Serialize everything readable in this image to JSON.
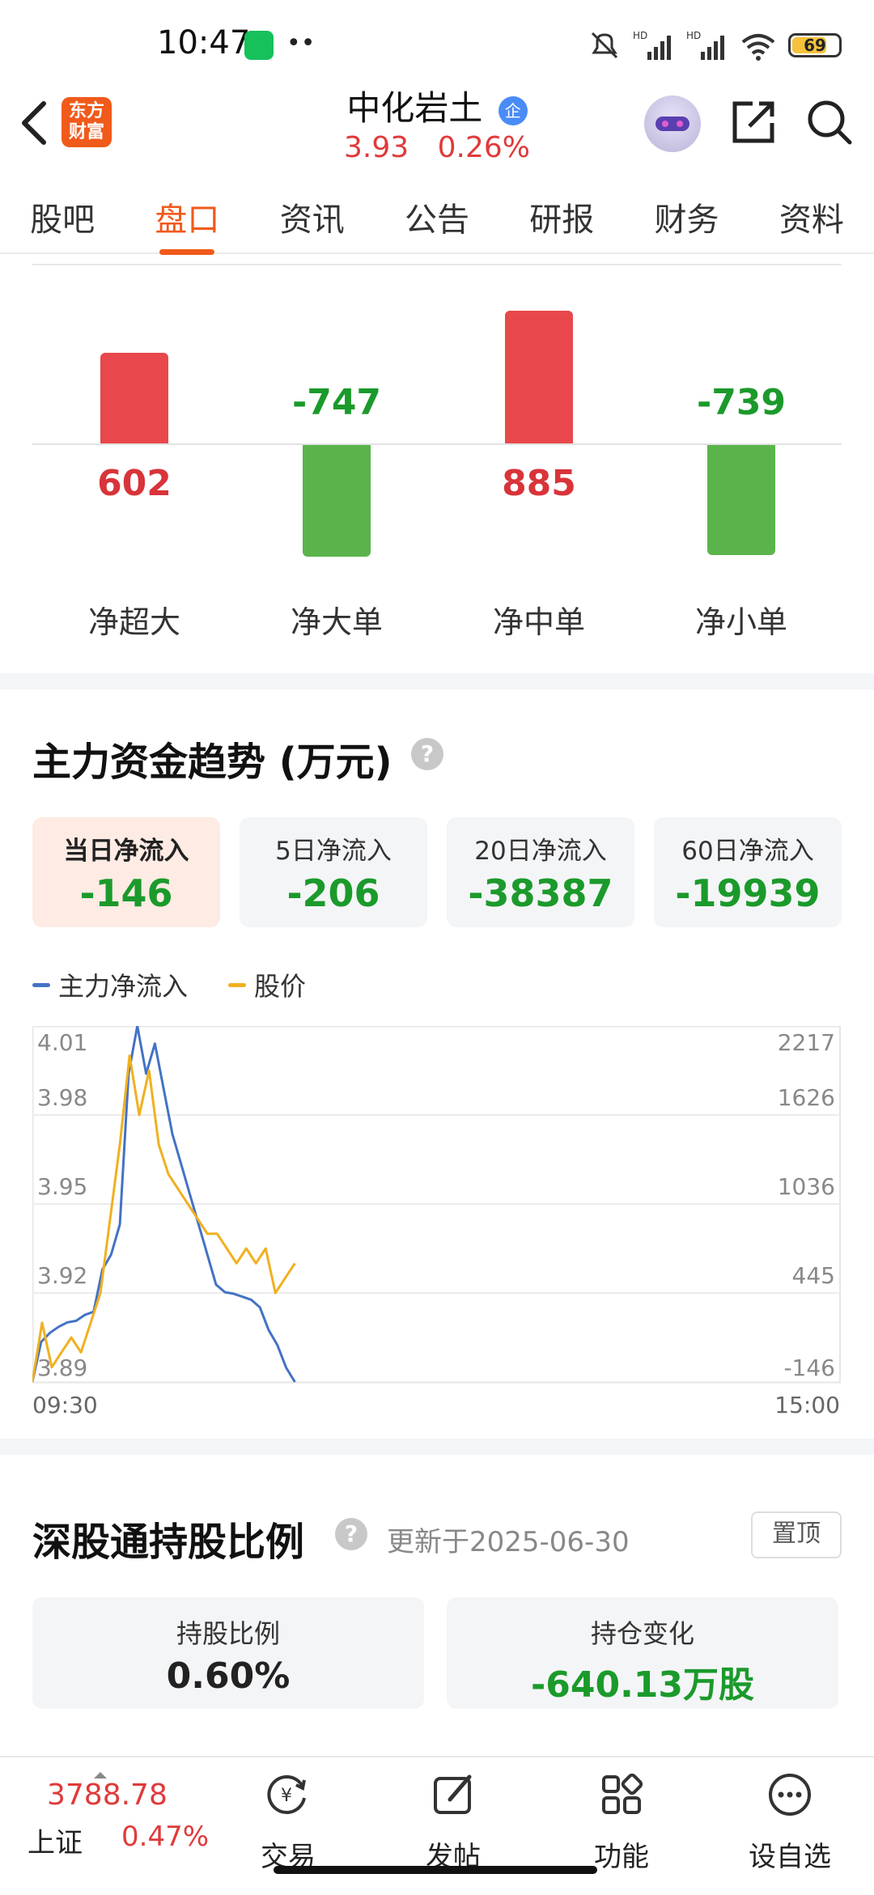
{
  "status_bar": {
    "time": "10:47",
    "battery": "69"
  },
  "header": {
    "logo_line1": "东方",
    "logo_line2": "财富",
    "stock_name": "中化岩土",
    "badge": "企",
    "price": "3.93",
    "change_pct": "0.26%"
  },
  "tabs": [
    "股吧",
    "盘口",
    "资讯",
    "公告",
    "研报",
    "财务",
    "资料"
  ],
  "active_tab": "盘口",
  "net_flow": [
    {
      "label": "净超大",
      "value": "602"
    },
    {
      "label": "净大单",
      "value": "-747"
    },
    {
      "label": "净中单",
      "value": "885"
    },
    {
      "label": "净小单",
      "value": "-739"
    }
  ],
  "trend": {
    "title": "主力资金趋势 (万元)",
    "cards": [
      {
        "label": "当日净流入",
        "value": "-146"
      },
      {
        "label": "5日净流入",
        "value": "-206"
      },
      {
        "label": "20日净流入",
        "value": "-38387"
      },
      {
        "label": "60日净流入",
        "value": "-19939"
      }
    ],
    "legend_main": "主力净流入",
    "legend_price": "股价"
  },
  "chart_data": {
    "type": "line",
    "x_start": "09:30",
    "x_end": "15:00",
    "left_ticks": [
      "4.01",
      "3.98",
      "3.95",
      "3.92",
      "3.89"
    ],
    "right_ticks": [
      "2217",
      "1626",
      "1036",
      "445",
      "-146"
    ],
    "colors": {
      "main": "#4472c4",
      "price": "#f0b020"
    },
    "series": [
      {
        "name": "主力净流入",
        "axis": "right",
        "values": [
          -146,
          120,
          180,
          220,
          250,
          260,
          300,
          320,
          600,
          700,
          900,
          1900,
          2217,
          1900,
          2100,
          1800,
          1500,
          1300,
          1100,
          900,
          700,
          500,
          450,
          440,
          420,
          400,
          350,
          200,
          100,
          -50,
          -146
        ]
      },
      {
        "name": "股价",
        "axis": "left",
        "values": [
          3.89,
          3.91,
          3.895,
          3.9,
          3.905,
          3.9,
          3.91,
          3.92,
          3.945,
          3.97,
          4.0,
          3.98,
          3.995,
          3.97,
          3.96,
          3.955,
          3.95,
          3.945,
          3.94,
          3.94,
          3.935,
          3.93,
          3.935,
          3.93,
          3.935,
          3.92,
          3.925,
          3.93
        ]
      }
    ]
  },
  "hold": {
    "title": "深股通持股比例",
    "updated": "更新于2025-06-30",
    "pin_label": "置顶",
    "ratio_label": "持股比例",
    "ratio_value": "0.60%",
    "change_label": "持仓变化",
    "change_value": "-640.13万股"
  },
  "bottom_nav": {
    "index_value": "3788.78",
    "index_name": "上证",
    "index_pct": "0.47%",
    "items": [
      "交易",
      "发帖",
      "功能",
      "设自选"
    ]
  }
}
